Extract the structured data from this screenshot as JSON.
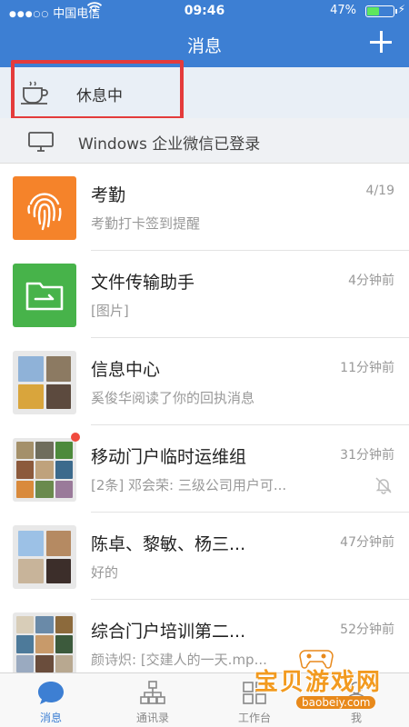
{
  "status": {
    "carrier": "中国电信",
    "time": "09:46",
    "battery": "47%",
    "battery_level": 0.47
  },
  "header": {
    "title": "消息"
  },
  "rest": {
    "label": "休息中"
  },
  "login": {
    "label": "Windows 企业微信已登录"
  },
  "conversations": [
    {
      "name": "考勤",
      "time": "4/19",
      "preview": "考勤打卡签到提醒",
      "avatar": "fingerprint-icon"
    },
    {
      "name": "文件传输助手",
      "time": "4分钟前",
      "preview": "[图片]",
      "avatar": "folder-transfer-icon"
    },
    {
      "name": "信息中心",
      "time": "11分钟前",
      "preview": "奚俊华阅读了你的回执消息",
      "avatar": "group-avatar"
    },
    {
      "name": "移动门户临时运维组",
      "time": "31分钟前",
      "preview": "[2条] 邓会荣: 三级公司用户可...",
      "avatar": "group-avatar",
      "muted": true,
      "unread_dot": true
    },
    {
      "name": "陈卓、黎敏、杨三...",
      "time": "47分钟前",
      "preview": "好的",
      "avatar": "group-avatar"
    },
    {
      "name": "综合门户培训第二...",
      "time": "52分钟前",
      "preview": "颜诗炽: [交建人的一天.mp...",
      "avatar": "group-avatar"
    }
  ],
  "tabs": [
    {
      "label": "消息",
      "icon": "chat-bubble-icon",
      "active": true
    },
    {
      "label": "通讯录",
      "icon": "org-chart-icon",
      "active": false
    },
    {
      "label": "工作台",
      "icon": "workbench-grid-icon",
      "active": false
    },
    {
      "label": "我",
      "icon": "person-icon",
      "active": false
    }
  ],
  "watermark": {
    "text": "宝贝游戏网",
    "url": "baobeiy.com"
  },
  "colors": {
    "brand": "#3d7fd3",
    "highlight": "#e43b3b",
    "attendance": "#f5832a",
    "file": "#47b34a"
  }
}
